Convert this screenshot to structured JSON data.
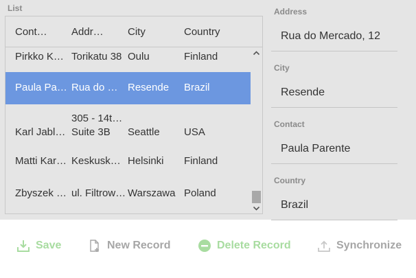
{
  "list": {
    "label": "List",
    "columns": [
      "Cont…",
      "Addr…",
      "City",
      "Country"
    ],
    "rows": [
      {
        "contact": "Pirkko K…",
        "address": "Torikatu 38",
        "city": "Oulu",
        "country": "Finland"
      },
      {
        "contact": "Paula Pa…",
        "address": "Rua do …",
        "city": "Resende",
        "country": "Brazil",
        "selected": true
      },
      {
        "contact": "Karl Jabl…",
        "address_line1": "305 - 14t…",
        "address_line2": "Suite 3B",
        "city": "Seattle",
        "country": "USA"
      },
      {
        "contact": "Matti Kar…",
        "address": "Keskusk…",
        "city": "Helsinki",
        "country": "Finland"
      },
      {
        "contact": "Zbyszek …",
        "address": "ul. Filtrow…",
        "city": "Warszawa",
        "country": "Poland"
      }
    ]
  },
  "form": {
    "fields": [
      {
        "label": "Address",
        "value": "Rua do Mercado, 12"
      },
      {
        "label": "City",
        "value": "Resende"
      },
      {
        "label": "Contact",
        "value": "Paula Parente"
      },
      {
        "label": "Country",
        "value": "Brazil"
      }
    ]
  },
  "toolbar": {
    "save_label": "Save",
    "new_label": "New Record",
    "delete_label": "Delete Record",
    "sync_label": "Synchronize"
  },
  "colors": {
    "selected_row": "#6c97e0",
    "enabled_action": "#a8dca0",
    "disabled_action": "#a6a6a6"
  },
  "icons": [
    "save-icon",
    "new-record-icon",
    "delete-icon",
    "synchronize-icon",
    "scroll-up-arrow-icon",
    "scroll-down-arrow-icon"
  ]
}
